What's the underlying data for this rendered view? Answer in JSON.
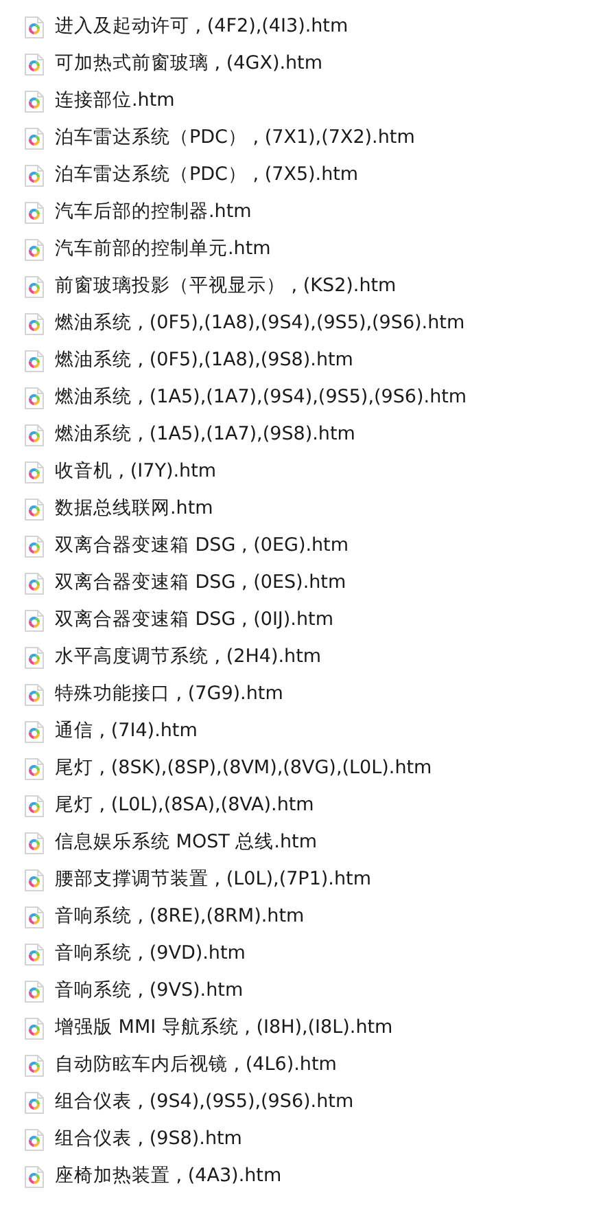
{
  "files": [
    {
      "name": "进入及起动许可 , (4F2),(4I3).htm"
    },
    {
      "name": "可加热式前窗玻璃 , (4GX).htm"
    },
    {
      "name": "连接部位.htm"
    },
    {
      "name": "泊车雷达系统（PDC） , (7X1),(7X2).htm"
    },
    {
      "name": "泊车雷达系统（PDC） , (7X5).htm"
    },
    {
      "name": "汽车后部的控制器.htm"
    },
    {
      "name": "汽车前部的控制单元.htm"
    },
    {
      "name": "前窗玻璃投影（平视显示） , (KS2).htm"
    },
    {
      "name": "燃油系统 , (0F5),(1A8),(9S4),(9S5),(9S6).htm"
    },
    {
      "name": "燃油系统 , (0F5),(1A8),(9S8).htm"
    },
    {
      "name": "燃油系统 , (1A5),(1A7),(9S4),(9S5),(9S6).htm"
    },
    {
      "name": "燃油系统 , (1A5),(1A7),(9S8).htm"
    },
    {
      "name": "收音机 , (I7Y).htm"
    },
    {
      "name": "数据总线联网.htm"
    },
    {
      "name": "双离合器变速箱 DSG , (0EG).htm"
    },
    {
      "name": "双离合器变速箱 DSG , (0ES).htm"
    },
    {
      "name": "双离合器变速箱 DSG , (0IJ).htm"
    },
    {
      "name": "水平高度调节系统 , (2H4).htm"
    },
    {
      "name": "特殊功能接口 , (7G9).htm"
    },
    {
      "name": "通信 , (7I4).htm"
    },
    {
      "name": "尾灯 , (8SK),(8SP),(8VM),(8VG),(L0L).htm"
    },
    {
      "name": "尾灯 , (L0L),(8SA),(8VA).htm"
    },
    {
      "name": "信息娱乐系统 MOST 总线.htm"
    },
    {
      "name": "腰部支撑调节装置 , (L0L),(7P1).htm"
    },
    {
      "name": "音响系统 , (8RE),(8RM).htm"
    },
    {
      "name": "音响系统 , (9VD).htm"
    },
    {
      "name": "音响系统 , (9VS).htm"
    },
    {
      "name": "增强版 MMI 导航系统 , (I8H),(I8L).htm"
    },
    {
      "name": "自动防眩车内后视镜 , (4L6).htm"
    },
    {
      "name": "组合仪表 , (9S4),(9S5),(9S6).htm"
    },
    {
      "name": "组合仪表 , (9S8).htm"
    },
    {
      "name": "座椅加热装置 , (4A3).htm"
    }
  ]
}
